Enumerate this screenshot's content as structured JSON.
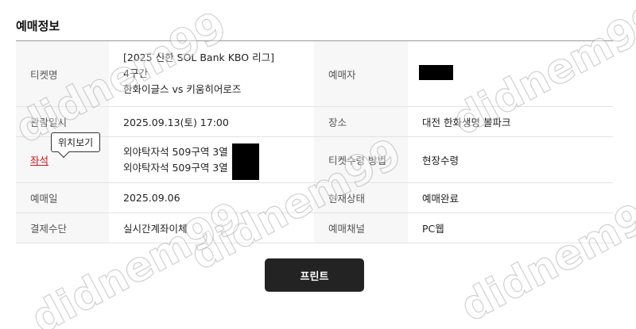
{
  "section": {
    "title": "예매정보"
  },
  "rows": {
    "ticket_name": {
      "label": "티켓명",
      "lines": [
        "[2025 신한 SOL Bank KBO 리그]",
        "4구간",
        "한화이글스 vs 키움히어로즈"
      ]
    },
    "buyer": {
      "label": "예매자",
      "value": ""
    },
    "view_datetime": {
      "label": "관람일시",
      "value": "2025.09.13(토) 17:00"
    },
    "venue": {
      "label": "장소",
      "value": "대전 한화생명 볼파크"
    },
    "seat": {
      "label": "좌석",
      "tooltip": "위치보기",
      "lines": [
        "외야탁자석 509구역 3열",
        "외야탁자석 509구역 3열"
      ]
    },
    "ticket_receive": {
      "label": "티켓수령 방법",
      "value": "현장수령"
    },
    "booking_date": {
      "label": "예매일",
      "value": "2025.09.06"
    },
    "status": {
      "label": "현재상태",
      "value": "예매완료"
    },
    "payment": {
      "label": "결제수단",
      "value": "실시간계좌이체"
    },
    "channel": {
      "label": "예매채널",
      "value": "PC웹"
    }
  },
  "actions": {
    "print_label": "프린트"
  },
  "watermark": {
    "text": "didnem99"
  }
}
